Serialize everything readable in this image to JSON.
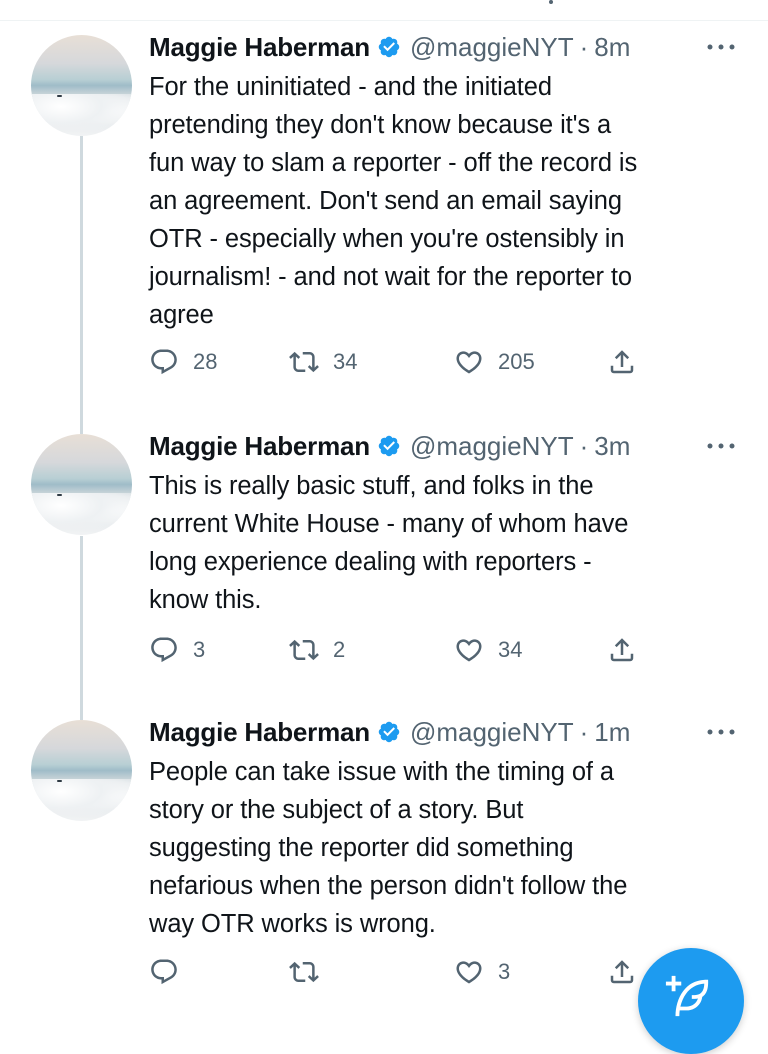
{
  "tweets": [
    {
      "name": "Maggie Haberman",
      "handle": "@maggieNYT",
      "time": "8m",
      "text": "For the uninitiated - and the initiated\npretending they don't know because it's a\nfun way to slam a reporter - off the record is\nan agreement. Don't send an email saying\nOTR - especially when you're ostensibly in\njournalism! - and not wait for the reporter to\nagree",
      "replies": "28",
      "retweets": "34",
      "likes": "205"
    },
    {
      "name": "Maggie Haberman",
      "handle": "@maggieNYT",
      "time": "3m",
      "text": "This is really basic stuff, and folks in the\ncurrent White House - many of whom have\nlong experience dealing with reporters -\nknow this.",
      "replies": "3",
      "retweets": "2",
      "likes": "34"
    },
    {
      "name": "Maggie Haberman",
      "handle": "@maggieNYT",
      "time": "1m",
      "text": "People can take issue with the timing of a\nstory or the subject of a story. But\nsuggesting the reporter did something\nnefarious when the person didn't follow the\nway OTR works is wrong.",
      "replies": "",
      "retweets": "",
      "likes": "3"
    }
  ],
  "separator": "·",
  "colors": {
    "verified": "#1d9bf0",
    "secondary_text": "#536471",
    "fab": "#1d9bf0",
    "thread_line": "#cfd9de"
  },
  "icons": {
    "verified": "verified-badge-icon",
    "reply": "reply-icon",
    "retweet": "retweet-icon",
    "like": "heart-icon",
    "share": "share-icon",
    "more": "more-dots-icon",
    "compose": "compose-tweet-icon"
  }
}
